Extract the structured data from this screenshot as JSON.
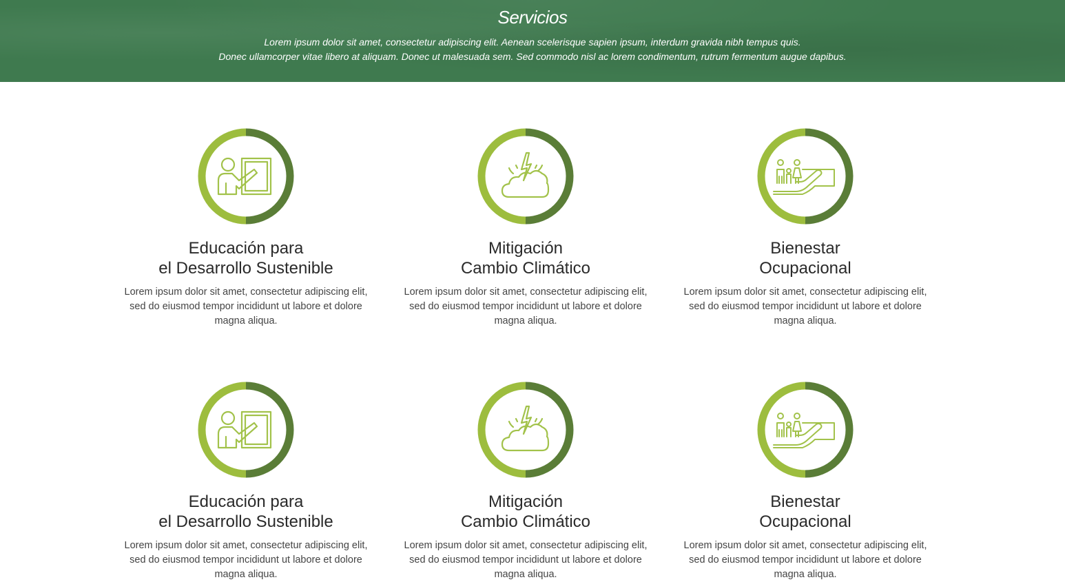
{
  "hero": {
    "title": "Servicios",
    "line1": "Lorem ipsum dolor sit amet, consectetur adipiscing elit. Aenean scelerisque sapien ipsum, interdum gravida nibh tempus quis.",
    "line2": "Donec ullamcorper vitae libero at aliquam. Donec ut malesuada sem. Sed commodo nisl ac lorem condimentum, rutrum fermentum augue dapibus."
  },
  "colors": {
    "hero_bg": "#3f7a4f",
    "ring_light": "#9dbd3e",
    "ring_dark": "#5a7d37",
    "icon": "#a2c24a"
  },
  "services": [
    {
      "icon": "teacher-board-icon",
      "title_line1": "Educación para",
      "title_line2": "el Desarrollo Sustenible",
      "text_line1": "Lorem ipsum dolor sit amet, consectetur adipiscing elit,",
      "text_line2": "sed do eiusmod tempor incididunt ut labore et dolore",
      "text_line3": "magna aliqua."
    },
    {
      "icon": "cloud-lightning-icon",
      "title_line1": "Mitigación",
      "title_line2": "Cambio Climático",
      "text_line1": "Lorem ipsum dolor sit amet, consectetur adipiscing elit,",
      "text_line2": "sed do eiusmod tempor incididunt ut labore et dolore",
      "text_line3": "magna aliqua."
    },
    {
      "icon": "family-hand-icon",
      "title_line1": "Bienestar",
      "title_line2": "Ocupacional",
      "text_line1": "Lorem ipsum dolor sit amet, consectetur adipiscing elit,",
      "text_line2": "sed do eiusmod tempor incididunt ut labore et dolore",
      "text_line3": "magna aliqua."
    },
    {
      "icon": "teacher-board-icon",
      "title_line1": "Educación para",
      "title_line2": "el Desarrollo Sustenible",
      "text_line1": "Lorem ipsum dolor sit amet, consectetur adipiscing elit,",
      "text_line2": "sed do eiusmod tempor incididunt ut labore et dolore",
      "text_line3": "magna aliqua."
    },
    {
      "icon": "cloud-lightning-icon",
      "title_line1": "Mitigación",
      "title_line2": "Cambio Climático",
      "text_line1": "Lorem ipsum dolor sit amet, consectetur adipiscing elit,",
      "text_line2": "sed do eiusmod tempor incididunt ut labore et dolore",
      "text_line3": "magna aliqua."
    },
    {
      "icon": "family-hand-icon",
      "title_line1": "Bienestar",
      "title_line2": "Ocupacional",
      "text_line1": "Lorem ipsum dolor sit amet, consectetur adipiscing elit,",
      "text_line2": "sed do eiusmod tempor incididunt ut labore et dolore",
      "text_line3": "magna aliqua."
    }
  ]
}
